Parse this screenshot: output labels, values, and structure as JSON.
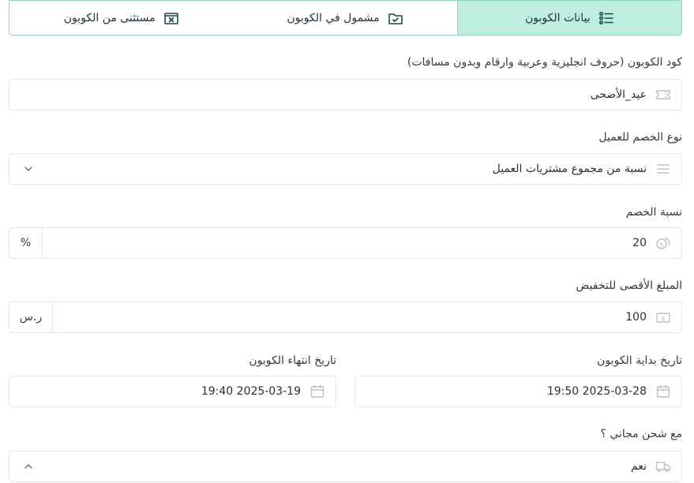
{
  "tabs": [
    {
      "label": "بيانات الكوبون",
      "icon": "list-icon",
      "active": true
    },
    {
      "label": "مشمول في الكوبون",
      "icon": "folder-check-icon",
      "active": false
    },
    {
      "label": "مستثنى من الكوبون",
      "icon": "box-x-icon",
      "active": false
    }
  ],
  "coupon_code": {
    "label": "كود الكوبون (حروف انجليزية وعربية وارقام وبدون مسافات)",
    "value": "عيد_الأضحى"
  },
  "discount_type": {
    "label": "نوع الخصم للعميل",
    "value": "نسبة من مجموع مشتريات العميل"
  },
  "discount_percent": {
    "label": "نسبة الخصم",
    "value": "20",
    "unit": "%"
  },
  "max_discount": {
    "label": "المبلغ الأقصى للتخفيض",
    "value": "100",
    "unit": "ر.س"
  },
  "start_date": {
    "label": "تاريخ بداية الكوبون",
    "value": "2025-03-28 19:50"
  },
  "end_date": {
    "label": "تاريخ انتهاء الكوبون",
    "value": "2025-03-19 19:40"
  },
  "free_shipping": {
    "label": "مع شحن مجاني ؟",
    "value": "نعم"
  },
  "colors": {
    "accent": "#bdeedf",
    "accent_border": "#8fd7c3",
    "icon": "#b9c0c6",
    "tab_icon": "#1d4a44"
  }
}
